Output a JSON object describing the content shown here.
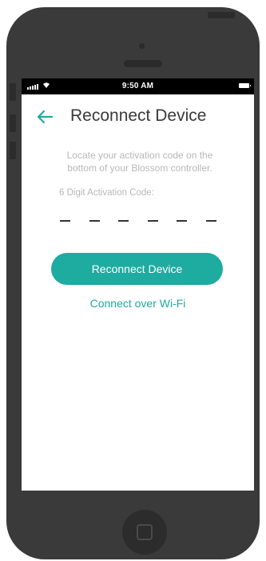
{
  "status_bar": {
    "time": "9:50 AM"
  },
  "header": {
    "title": "Reconnect Device",
    "back_icon": "back-arrow-icon"
  },
  "instructions": {
    "text": "Locate your activation code on the bottom of your Blossom controller."
  },
  "activation_code": {
    "label": "6 Digit Activation Code:",
    "digits": [
      "",
      "",
      "",
      "",
      "",
      ""
    ]
  },
  "actions": {
    "primary_label": "Reconnect Device",
    "secondary_label": "Connect over Wi-Fi"
  },
  "colors": {
    "accent": "#1eaba0",
    "title": "#3a3a3a",
    "muted_text": "#b8b8b8",
    "phone_body": "#3a3a3a"
  }
}
